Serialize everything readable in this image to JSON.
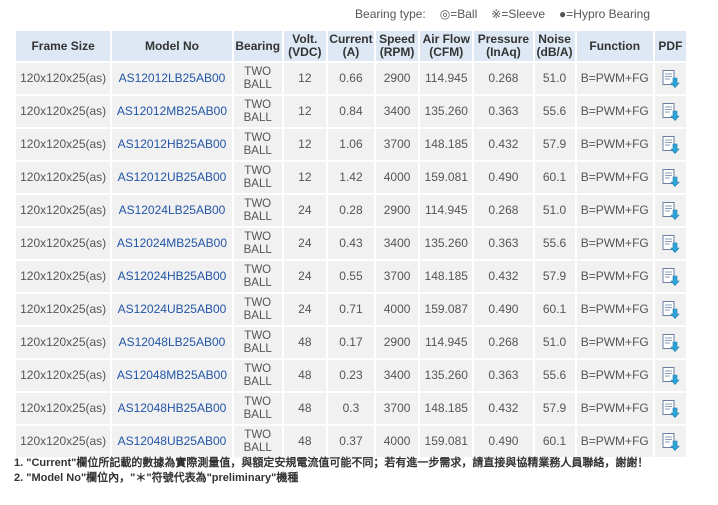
{
  "legend": {
    "title": "Bearing type:",
    "items": [
      "◎=Ball",
      "※=Sleeve",
      "●=Hypro Bearing"
    ]
  },
  "columns": [
    "Frame Size",
    "Model No",
    "Bearing",
    "Volt. (VDC)",
    "Current (A)",
    "Speed (RPM)",
    "Air Flow (CFM)",
    "Pressure (InAq)",
    "Noise (dB/A)",
    "Function",
    "PDF"
  ],
  "rows": [
    {
      "frame": "120x120x25(as)",
      "model": "AS12012LB25AB00",
      "bearing_1": "TWO",
      "bearing_2": "BALL",
      "volt": "12",
      "current": "0.66",
      "speed": "2900",
      "airflow": "114.945",
      "pressure": "0.268",
      "noise": "51.0",
      "function": "B=PWM+FG",
      "pdf_icon": "pdf-download-icon"
    },
    {
      "frame": "120x120x25(as)",
      "model": "AS12012MB25AB00",
      "bearing_1": "TWO",
      "bearing_2": "BALL",
      "volt": "12",
      "current": "0.84",
      "speed": "3400",
      "airflow": "135.260",
      "pressure": "0.363",
      "noise": "55.6",
      "function": "B=PWM+FG",
      "pdf_icon": "pdf-download-icon"
    },
    {
      "frame": "120x120x25(as)",
      "model": "AS12012HB25AB00",
      "bearing_1": "TWO",
      "bearing_2": "BALL",
      "volt": "12",
      "current": "1.06",
      "speed": "3700",
      "airflow": "148.185",
      "pressure": "0.432",
      "noise": "57.9",
      "function": "B=PWM+FG",
      "pdf_icon": "pdf-download-icon"
    },
    {
      "frame": "120x120x25(as)",
      "model": "AS12012UB25AB00",
      "bearing_1": "TWO",
      "bearing_2": "BALL",
      "volt": "12",
      "current": "1.42",
      "speed": "4000",
      "airflow": "159.081",
      "pressure": "0.490",
      "noise": "60.1",
      "function": "B=PWM+FG",
      "pdf_icon": "pdf-download-icon"
    },
    {
      "frame": "120x120x25(as)",
      "model": "AS12024LB25AB00",
      "bearing_1": "TWO",
      "bearing_2": "BALL",
      "volt": "24",
      "current": "0.28",
      "speed": "2900",
      "airflow": "114.945",
      "pressure": "0.268",
      "noise": "51.0",
      "function": "B=PWM+FG",
      "pdf_icon": "pdf-download-icon"
    },
    {
      "frame": "120x120x25(as)",
      "model": "AS12024MB25AB00",
      "bearing_1": "TWO",
      "bearing_2": "BALL",
      "volt": "24",
      "current": "0.43",
      "speed": "3400",
      "airflow": "135.260",
      "pressure": "0.363",
      "noise": "55.6",
      "function": "B=PWM+FG",
      "pdf_icon": "pdf-download-icon"
    },
    {
      "frame": "120x120x25(as)",
      "model": "AS12024HB25AB00",
      "bearing_1": "TWO",
      "bearing_2": "BALL",
      "volt": "24",
      "current": "0.55",
      "speed": "3700",
      "airflow": "148.185",
      "pressure": "0.432",
      "noise": "57.9",
      "function": "B=PWM+FG",
      "pdf_icon": "pdf-download-icon"
    },
    {
      "frame": "120x120x25(as)",
      "model": "AS12024UB25AB00",
      "bearing_1": "TWO",
      "bearing_2": "BALL",
      "volt": "24",
      "current": "0.71",
      "speed": "4000",
      "airflow": "159.087",
      "pressure": "0.490",
      "noise": "60.1",
      "function": "B=PWM+FG",
      "pdf_icon": "pdf-download-icon"
    },
    {
      "frame": "120x120x25(as)",
      "model": "AS12048LB25AB00",
      "bearing_1": "TWO",
      "bearing_2": "BALL",
      "volt": "48",
      "current": "0.17",
      "speed": "2900",
      "airflow": "114.945",
      "pressure": "0.268",
      "noise": "51.0",
      "function": "B=PWM+FG",
      "pdf_icon": "pdf-download-icon"
    },
    {
      "frame": "120x120x25(as)",
      "model": "AS12048MB25AB00",
      "bearing_1": "TWO",
      "bearing_2": "BALL",
      "volt": "48",
      "current": "0.23",
      "speed": "3400",
      "airflow": "135.260",
      "pressure": "0.363",
      "noise": "55.6",
      "function": "B=PWM+FG",
      "pdf_icon": "pdf-download-icon"
    },
    {
      "frame": "120x120x25(as)",
      "model": "AS12048HB25AB00",
      "bearing_1": "TWO",
      "bearing_2": "BALL",
      "volt": "48",
      "current": "0.3",
      "speed": "3700",
      "airflow": "148.185",
      "pressure": "0.432",
      "noise": "57.9",
      "function": "B=PWM+FG",
      "pdf_icon": "pdf-download-icon"
    },
    {
      "frame": "120x120x25(as)",
      "model": "AS12048UB25AB00",
      "bearing_1": "TWO",
      "bearing_2": "BALL",
      "volt": "48",
      "current": "0.37",
      "speed": "4000",
      "airflow": "159.081",
      "pressure": "0.490",
      "noise": "60.1",
      "function": "B=PWM+FG",
      "pdf_icon": "pdf-download-icon"
    }
  ],
  "notes": [
    "1. \"Current\"欄位所記載的數據為實際測量值，與額定安規電流值可能不同；若有進一步需求，請直接與協精業務人員聯絡，謝謝！",
    "2. \"Model No\"欄位內，\"＊\"符號代表為\"preliminary\"機種"
  ],
  "colors": {
    "header_bg": "#dde8f4",
    "cell_bg": "#f1f1f1",
    "model_link": "#2255a8"
  }
}
